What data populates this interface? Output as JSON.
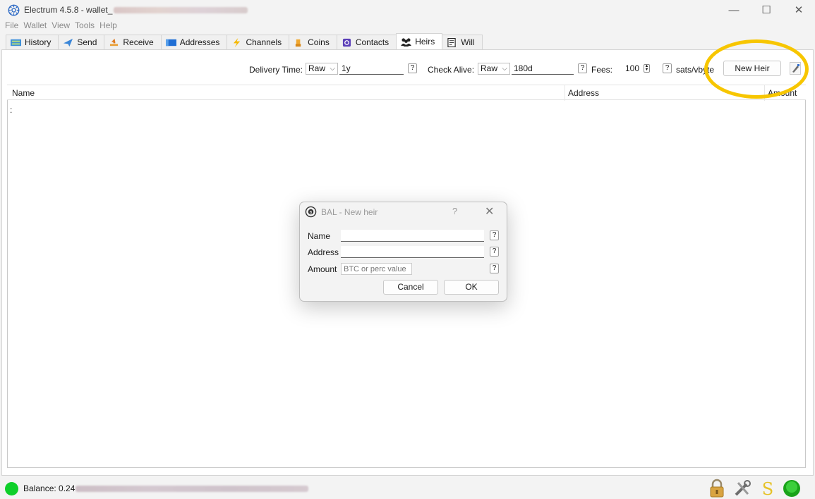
{
  "window": {
    "title_prefix": "Electrum 4.5.8  -  wallet_",
    "minimize_glyph": "—",
    "maximize_glyph": "☐",
    "close_glyph": "✕"
  },
  "menu": [
    "File",
    "Wallet",
    "View",
    "Tools",
    "Help"
  ],
  "tabs": [
    {
      "label": "History",
      "icon": "history-icon"
    },
    {
      "label": "Send",
      "icon": "send-icon"
    },
    {
      "label": "Receive",
      "icon": "receive-icon"
    },
    {
      "label": "Addresses",
      "icon": "addresses-icon"
    },
    {
      "label": "Channels",
      "icon": "lightning-icon"
    },
    {
      "label": "Coins",
      "icon": "coins-icon"
    },
    {
      "label": "Contacts",
      "icon": "contacts-icon"
    },
    {
      "label": "Heirs",
      "icon": "heirs-icon",
      "active": true
    },
    {
      "label": "Will",
      "icon": "will-icon"
    }
  ],
  "toolbar": {
    "delivery_label": "Delivery Time:",
    "delivery_mode": "Raw",
    "delivery_value": "1y",
    "check_label": "Check Alive:",
    "check_mode": "Raw",
    "check_value": "180d",
    "fees_label": "Fees:",
    "fees_value": "100",
    "fees_unit": "sats/vbyte",
    "new_heir_label": "New Heir",
    "help_glyph": "?"
  },
  "table": {
    "columns": [
      "Name",
      "Address",
      "Amount"
    ],
    "first_row_text": ":"
  },
  "dialog": {
    "title": "BAL - New heir",
    "help_glyph": "?",
    "close_glyph": "✕",
    "name_label": "Name",
    "address_label": "Address",
    "amount_label": "Amount",
    "amount_placeholder": "BTC or perc value",
    "cancel_label": "Cancel",
    "ok_label": "OK"
  },
  "status": {
    "balance_prefix": "Balance: 0.24",
    "indicator_color": "#0ecf2a"
  },
  "colors": {
    "highlight": "#f7c600",
    "connected": "#1aa31a"
  }
}
